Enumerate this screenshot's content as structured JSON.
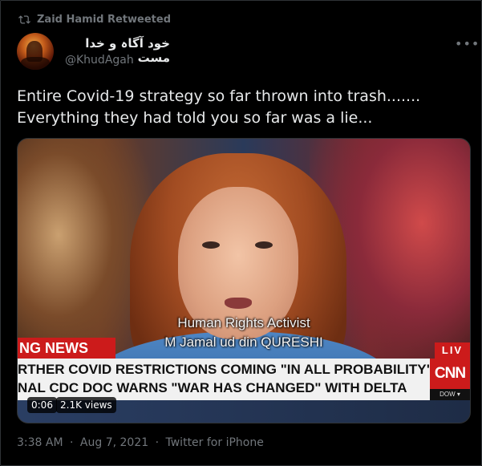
{
  "retweet": {
    "label": "Zaid Hamid Retweeted",
    "icon": "retweet-icon"
  },
  "author": {
    "name": "خود آگاہ و خدا مست",
    "handle": "@KhudAgah",
    "more_icon": "more-icon"
  },
  "tweet": {
    "lines": [
      "Entire Covid-19 strategy so far thrown into trash.......",
      "Everything they had told you so far was a lie..."
    ]
  },
  "media": {
    "subtitle_line1": "Human Rights Activist",
    "subtitle_line2": "M Jamal ud din QURESHI",
    "news_label": "NG NEWS",
    "live_label": "LIV",
    "ticker_line1": "RTHER COVID RESTRICTIONS COMING \"IN ALL PROBABILITY\"",
    "ticker_line2": "NAL CDC DOC WARNS \"WAR HAS CHANGED\" WITH DELTA",
    "network_logo": "CNN",
    "market_label": "DOW ▾",
    "duration": "0:06",
    "views": "2.1K views"
  },
  "footer": {
    "time": "3:38 AM",
    "date": "Aug 7, 2021",
    "source": "Twitter for iPhone",
    "separator": "·"
  }
}
